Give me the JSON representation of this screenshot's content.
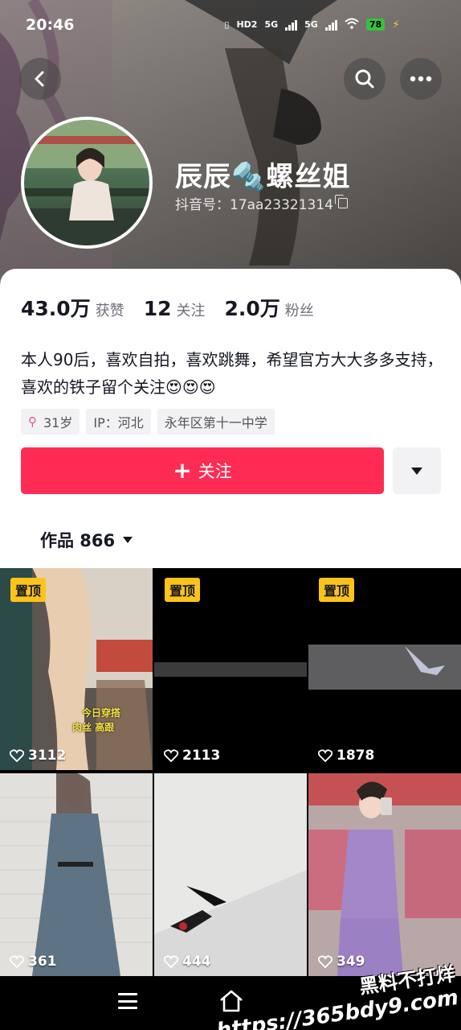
{
  "status_bar": {
    "time": "20:46",
    "network_labels": [
      "HD2",
      "5G",
      "5G"
    ],
    "battery": "78"
  },
  "header": {
    "back_icon": "chevron-left-icon",
    "search_icon": "search-icon",
    "more_icon": "more-horizontal-icon"
  },
  "profile": {
    "name_part1": "辰辰",
    "name_emoji": "🔩",
    "name_part2": "螺丝姐",
    "douyin_id": "抖音号：17aa23321314"
  },
  "stats": [
    {
      "value": "43.0万",
      "label": "获赞"
    },
    {
      "value": "12",
      "label": "关注"
    },
    {
      "value": "2.0万",
      "label": "粉丝"
    }
  ],
  "bio": "本人90后，喜欢自拍，喜欢跳舞，希望官方大大多多支持，喜欢的铁子留个关注😍😍😍",
  "tags": {
    "age": "31岁",
    "ip": "IP：河北",
    "school": "永年区第十一中学"
  },
  "actions": {
    "follow_label": "关注"
  },
  "works_tab": {
    "label": "作品 866"
  },
  "videos": [
    {
      "pinned_label": "置顶",
      "likes": "3112",
      "caption_line1": "今日穿搭",
      "caption_line2": "肉丝 高跟"
    },
    {
      "pinned_label": "置顶",
      "likes": "2113"
    },
    {
      "pinned_label": "置顶",
      "likes": "1878"
    },
    {
      "likes": "361"
    },
    {
      "likes": "444"
    },
    {
      "likes": "349"
    }
  ],
  "watermark": {
    "line1": "黑料不打烊",
    "line2": "https://365bdy9.com"
  },
  "colors": {
    "accent": "#fe2c55",
    "pin_badge": "#fcc419",
    "text_primary": "#161823",
    "text_secondary": "#6e6f78"
  }
}
